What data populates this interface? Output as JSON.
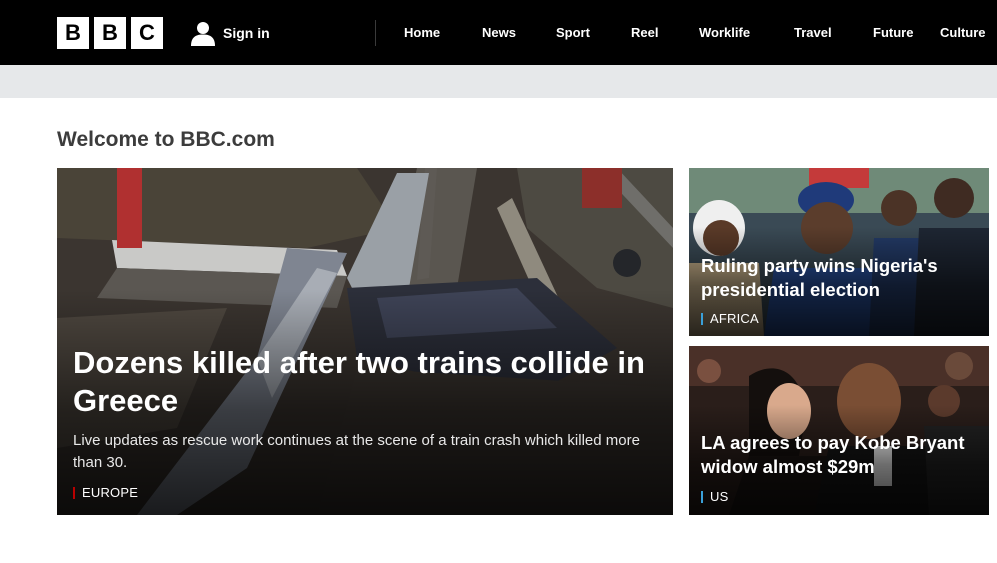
{
  "logo": {
    "letters": [
      "B",
      "B",
      "C"
    ]
  },
  "account": {
    "sign_in_label": "Sign in",
    "icon": "person-icon"
  },
  "nav": {
    "items": [
      "Home",
      "News",
      "Sport",
      "Reel",
      "Worklife",
      "Travel",
      "Future",
      "Culture"
    ]
  },
  "page": {
    "welcome_title": "Welcome to BBC.com"
  },
  "lead_story": {
    "headline": "Dozens killed after two trains collide in Greece",
    "summary": "Live updates as rescue work continues at the scene of a train crash which killed more than 30.",
    "tag": "EUROPE",
    "image": "train-crash-aerial-photo"
  },
  "side_stories": [
    {
      "headline": "Ruling party wins Nigeria's presidential election",
      "tag": "AFRICA",
      "image": "nigeria-election-crowd-photo"
    },
    {
      "headline": "LA agrees to pay Kobe Bryant widow almost $29m",
      "tag": "US",
      "image": "kobe-bryant-vanessa-photo"
    }
  ],
  "colors": {
    "header_bg": "#000000",
    "grey_band": "#e6e8ea",
    "europe_tag_accent": "#b80000",
    "world_tag_accent": "#3aa0d8"
  }
}
